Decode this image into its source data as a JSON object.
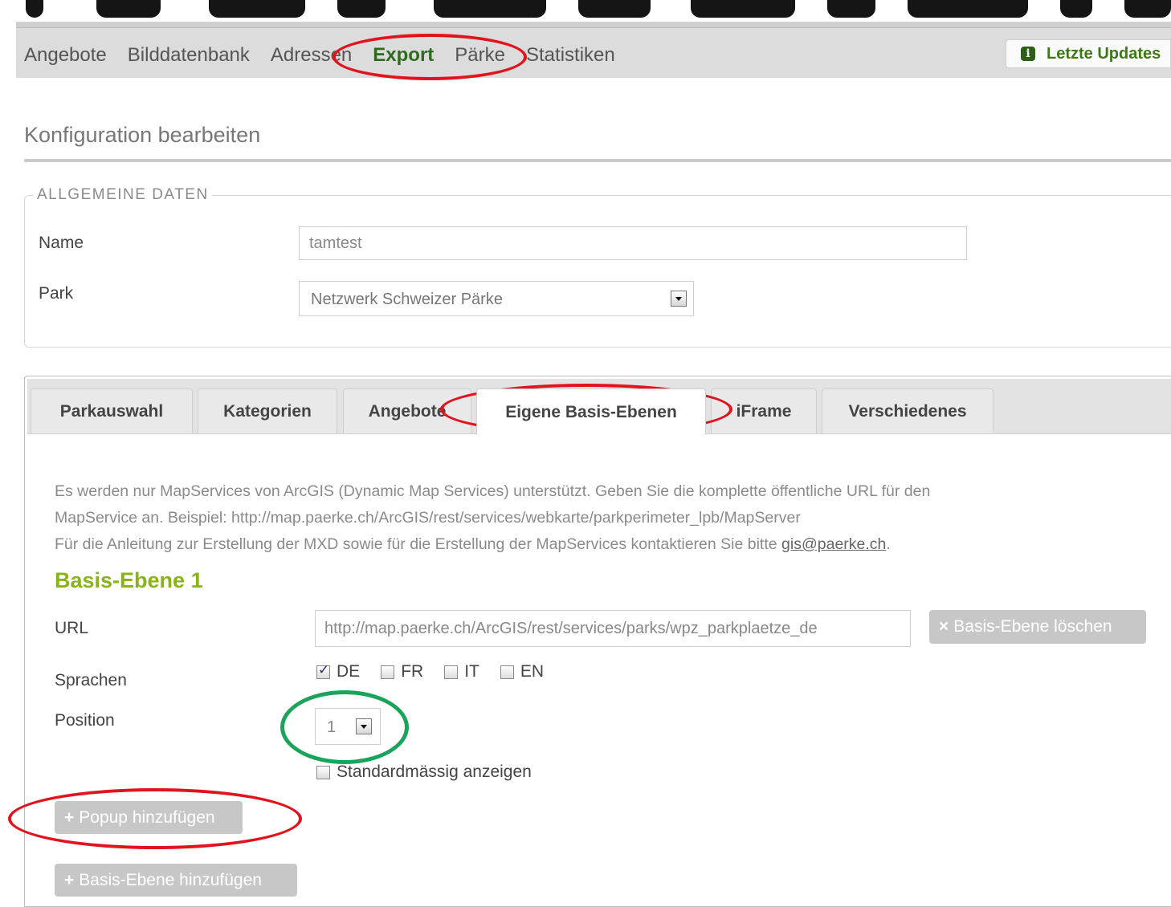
{
  "nav": {
    "items": [
      "Angebote",
      "Bilddatenbank",
      "Adressen",
      "Export",
      "Pärke",
      "Statistiken"
    ],
    "active_index": 3,
    "updates_label": "Letzte Updates"
  },
  "page": {
    "title": "Konfiguration bearbeiten"
  },
  "general": {
    "legend": "ALLGEMEINE DATEN",
    "name_label": "Name",
    "name_value": "tamtest",
    "park_label": "Park",
    "park_value": "Netzwerk Schweizer Pärke"
  },
  "tabs": [
    "Parkauswahl",
    "Kategorien",
    "Angebote",
    "Eigene Basis-Ebenen",
    "iFrame",
    "Verschiedenes"
  ],
  "active_tab_index": 3,
  "description": {
    "line1": "Es werden nur MapServices von ArcGIS (Dynamic Map Services) unterstützt. Geben Sie die komplette öffentliche URL für den",
    "line2": "MapService an. Beispiel: http://map.paerke.ch/ArcGIS/rest/services/webkarte/parkperimeter_lpb/MapServer",
    "line3_prefix": "Für die Anleitung zur Erstellung der MXD sowie für die Erstellung der MapServices kontaktieren Sie bitte ",
    "email": "gis@paerke.ch",
    "line3_suffix": "."
  },
  "layer": {
    "title": "Basis-Ebene 1",
    "url_label": "URL",
    "url_value": "http://map.paerke.ch/ArcGIS/rest/services/parks/wpz_parkplaetze_de",
    "delete_symbol": "×",
    "delete_label": "Basis-Ebene löschen",
    "languages_label": "Sprachen",
    "languages": [
      {
        "code": "DE",
        "checked": true
      },
      {
        "code": "FR",
        "checked": false
      },
      {
        "code": "IT",
        "checked": false
      },
      {
        "code": "EN",
        "checked": false
      }
    ],
    "position_label": "Position",
    "position_value": "1",
    "default_label": "Standardmässig anzeigen",
    "default_checked": false
  },
  "buttons": {
    "add_symbol": "+",
    "add_popup": "Popup hinzufügen",
    "add_layer": "Basis-Ebene hinzufügen"
  },
  "colors": {
    "nav_active": "#2d6b1c",
    "section_title": "#8ab31a",
    "annotation_red": "#e0141e",
    "annotation_green": "#1aa35a",
    "button_gray": "#c7c7c7"
  }
}
